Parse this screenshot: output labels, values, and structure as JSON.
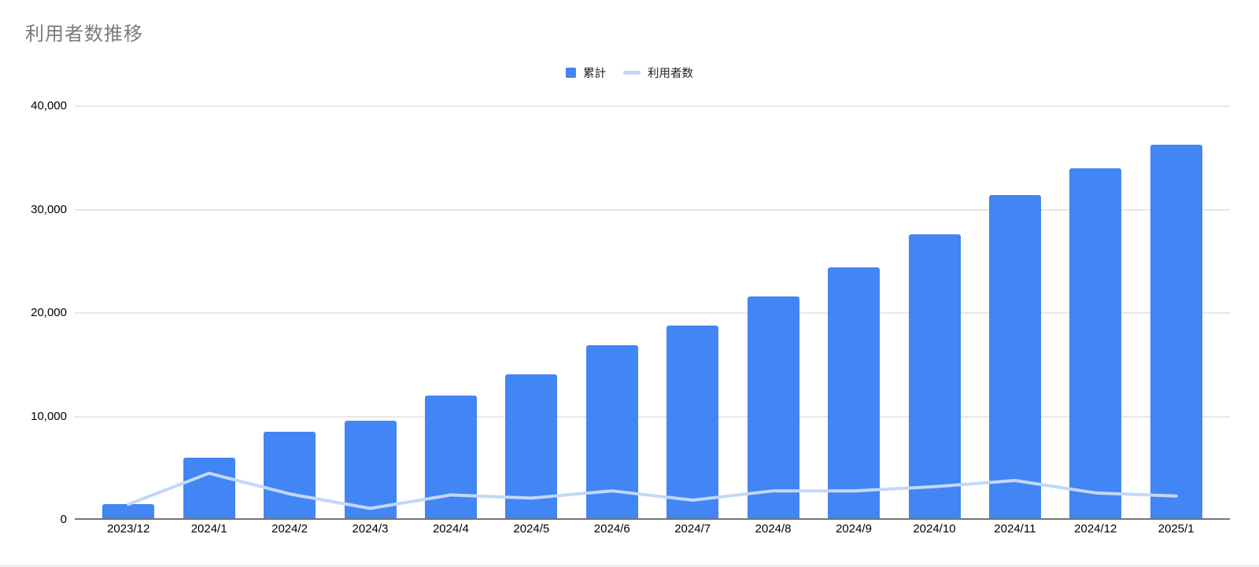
{
  "chart_data": {
    "type": "bar",
    "combo": "bar+line",
    "title": "利用者数推移",
    "categories": [
      "2023/12",
      "2024/1",
      "2024/2",
      "2024/3",
      "2024/4",
      "2024/5",
      "2024/6",
      "2024/7",
      "2024/8",
      "2024/9",
      "2024/10",
      "2024/11",
      "2024/12",
      "2025/1"
    ],
    "series": [
      {
        "name": "累計",
        "type": "bar",
        "color": "#4285f4",
        "values": [
          1500,
          6000,
          8500,
          9600,
          12000,
          14100,
          16900,
          18800,
          21600,
          24400,
          27600,
          31400,
          34000,
          36300
        ]
      },
      {
        "name": "利用者数",
        "type": "line",
        "color": "#c3d7f8",
        "values": [
          1500,
          4500,
          2500,
          1100,
          2400,
          2100,
          2800,
          1900,
          2800,
          2800,
          3200,
          3800,
          2600,
          2300
        ]
      }
    ],
    "xlabel": "",
    "ylabel": "",
    "ylim": [
      0,
      40000
    ],
    "yticks": [
      {
        "value": 0,
        "label": "0"
      },
      {
        "value": 10000,
        "label": "10,000"
      },
      {
        "value": 20000,
        "label": "20,000"
      },
      {
        "value": 30000,
        "label": "30,000"
      },
      {
        "value": 40000,
        "label": "40,000"
      }
    ],
    "grid": "horizontal",
    "legend_position": "top-center",
    "colors": {
      "title_text": "#7b7b7b",
      "tick_text": "#000000",
      "gridline": "#e7e7e7",
      "baseline": "#757575",
      "background": "#ffffff"
    }
  }
}
